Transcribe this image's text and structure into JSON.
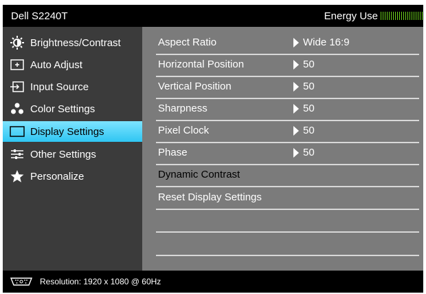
{
  "header": {
    "model": "Dell S2240T",
    "energy_label": "Energy Use",
    "energy_bar_color": "#6cd41b"
  },
  "sidebar": {
    "items": [
      {
        "label": "Brightness/Contrast",
        "icon": "brightness-icon"
      },
      {
        "label": "Auto Adjust",
        "icon": "auto-adjust-icon"
      },
      {
        "label": "Input Source",
        "icon": "input-source-icon"
      },
      {
        "label": "Color Settings",
        "icon": "color-settings-icon"
      },
      {
        "label": "Display Settings",
        "icon": "display-settings-icon",
        "selected": true
      },
      {
        "label": "Other Settings",
        "icon": "other-settings-icon"
      },
      {
        "label": "Personalize",
        "icon": "star-icon"
      }
    ]
  },
  "panel": {
    "rows": [
      {
        "label": "Aspect Ratio",
        "value": "Wide 16:9"
      },
      {
        "label": "Horizontal Position",
        "value": "50"
      },
      {
        "label": "Vertical Position",
        "value": "50"
      },
      {
        "label": "Sharpness",
        "value": "50"
      },
      {
        "label": "Pixel Clock",
        "value": "50"
      },
      {
        "label": "Phase",
        "value": "50"
      },
      {
        "label": "Dynamic Contrast",
        "value": ""
      },
      {
        "label": "Reset Display Settings",
        "value": ""
      },
      {
        "label": "",
        "value": ""
      },
      {
        "label": "",
        "value": ""
      }
    ]
  },
  "status": {
    "resolution": "Resolution: 1920 x 1080 @ 60Hz"
  },
  "colors": {
    "selection_top": "#7de4ff",
    "selection_bottom": "#2fc6f2",
    "panel_bg": "#7b7b7b",
    "sidebar_bg": "#3b3b3b"
  }
}
